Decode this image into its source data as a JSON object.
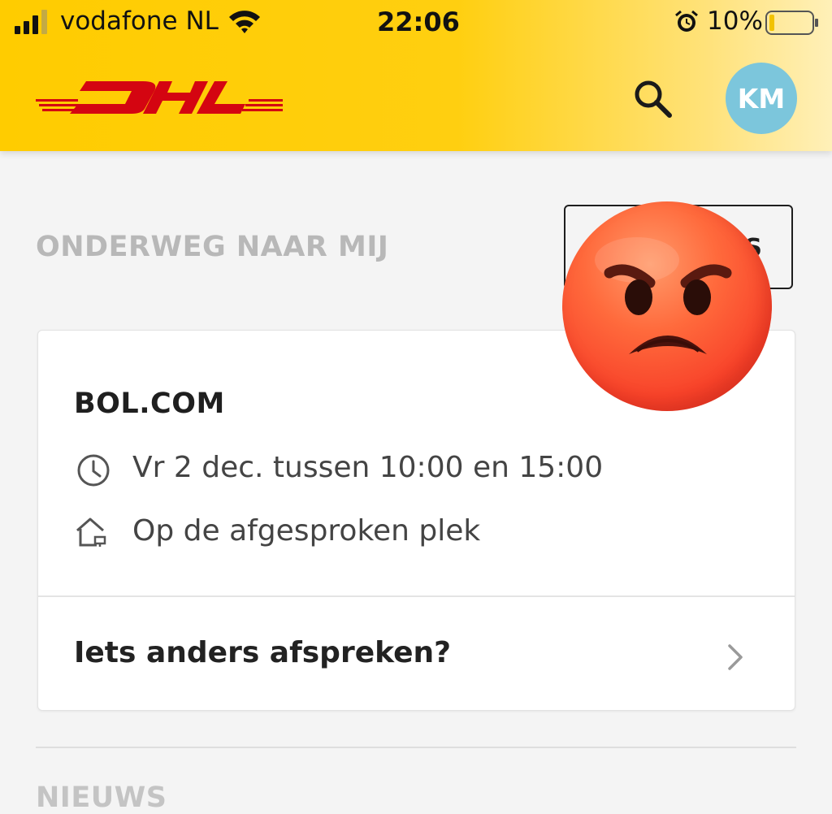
{
  "status_bar": {
    "carrier": "vodafone NL",
    "time": "22:06",
    "battery_percent": "10%",
    "battery_level": 0.1,
    "icons": [
      "signal-icon",
      "wifi-icon",
      "alarm-icon",
      "battery-icon"
    ]
  },
  "header": {
    "logo": "DHL",
    "avatar_initials": "KM",
    "search_icon": "search-icon",
    "colors": {
      "yellow": "#FFCC00",
      "red": "#D40511",
      "avatar": "#7CC6DC"
    }
  },
  "section": {
    "title": "ONDERWEG NAAR MIJ",
    "button_label": "S"
  },
  "shipment": {
    "sender": "BOL.COM",
    "delivery_time": "Vr 2 dec. tussen 10:00 en 15:00",
    "delivery_location": "Op de afgesproken plek",
    "action_label": "Iets anders afspreken?"
  },
  "news": {
    "title": "NIEUWS"
  },
  "overlay": {
    "emoji": "angry-face-emoji"
  }
}
